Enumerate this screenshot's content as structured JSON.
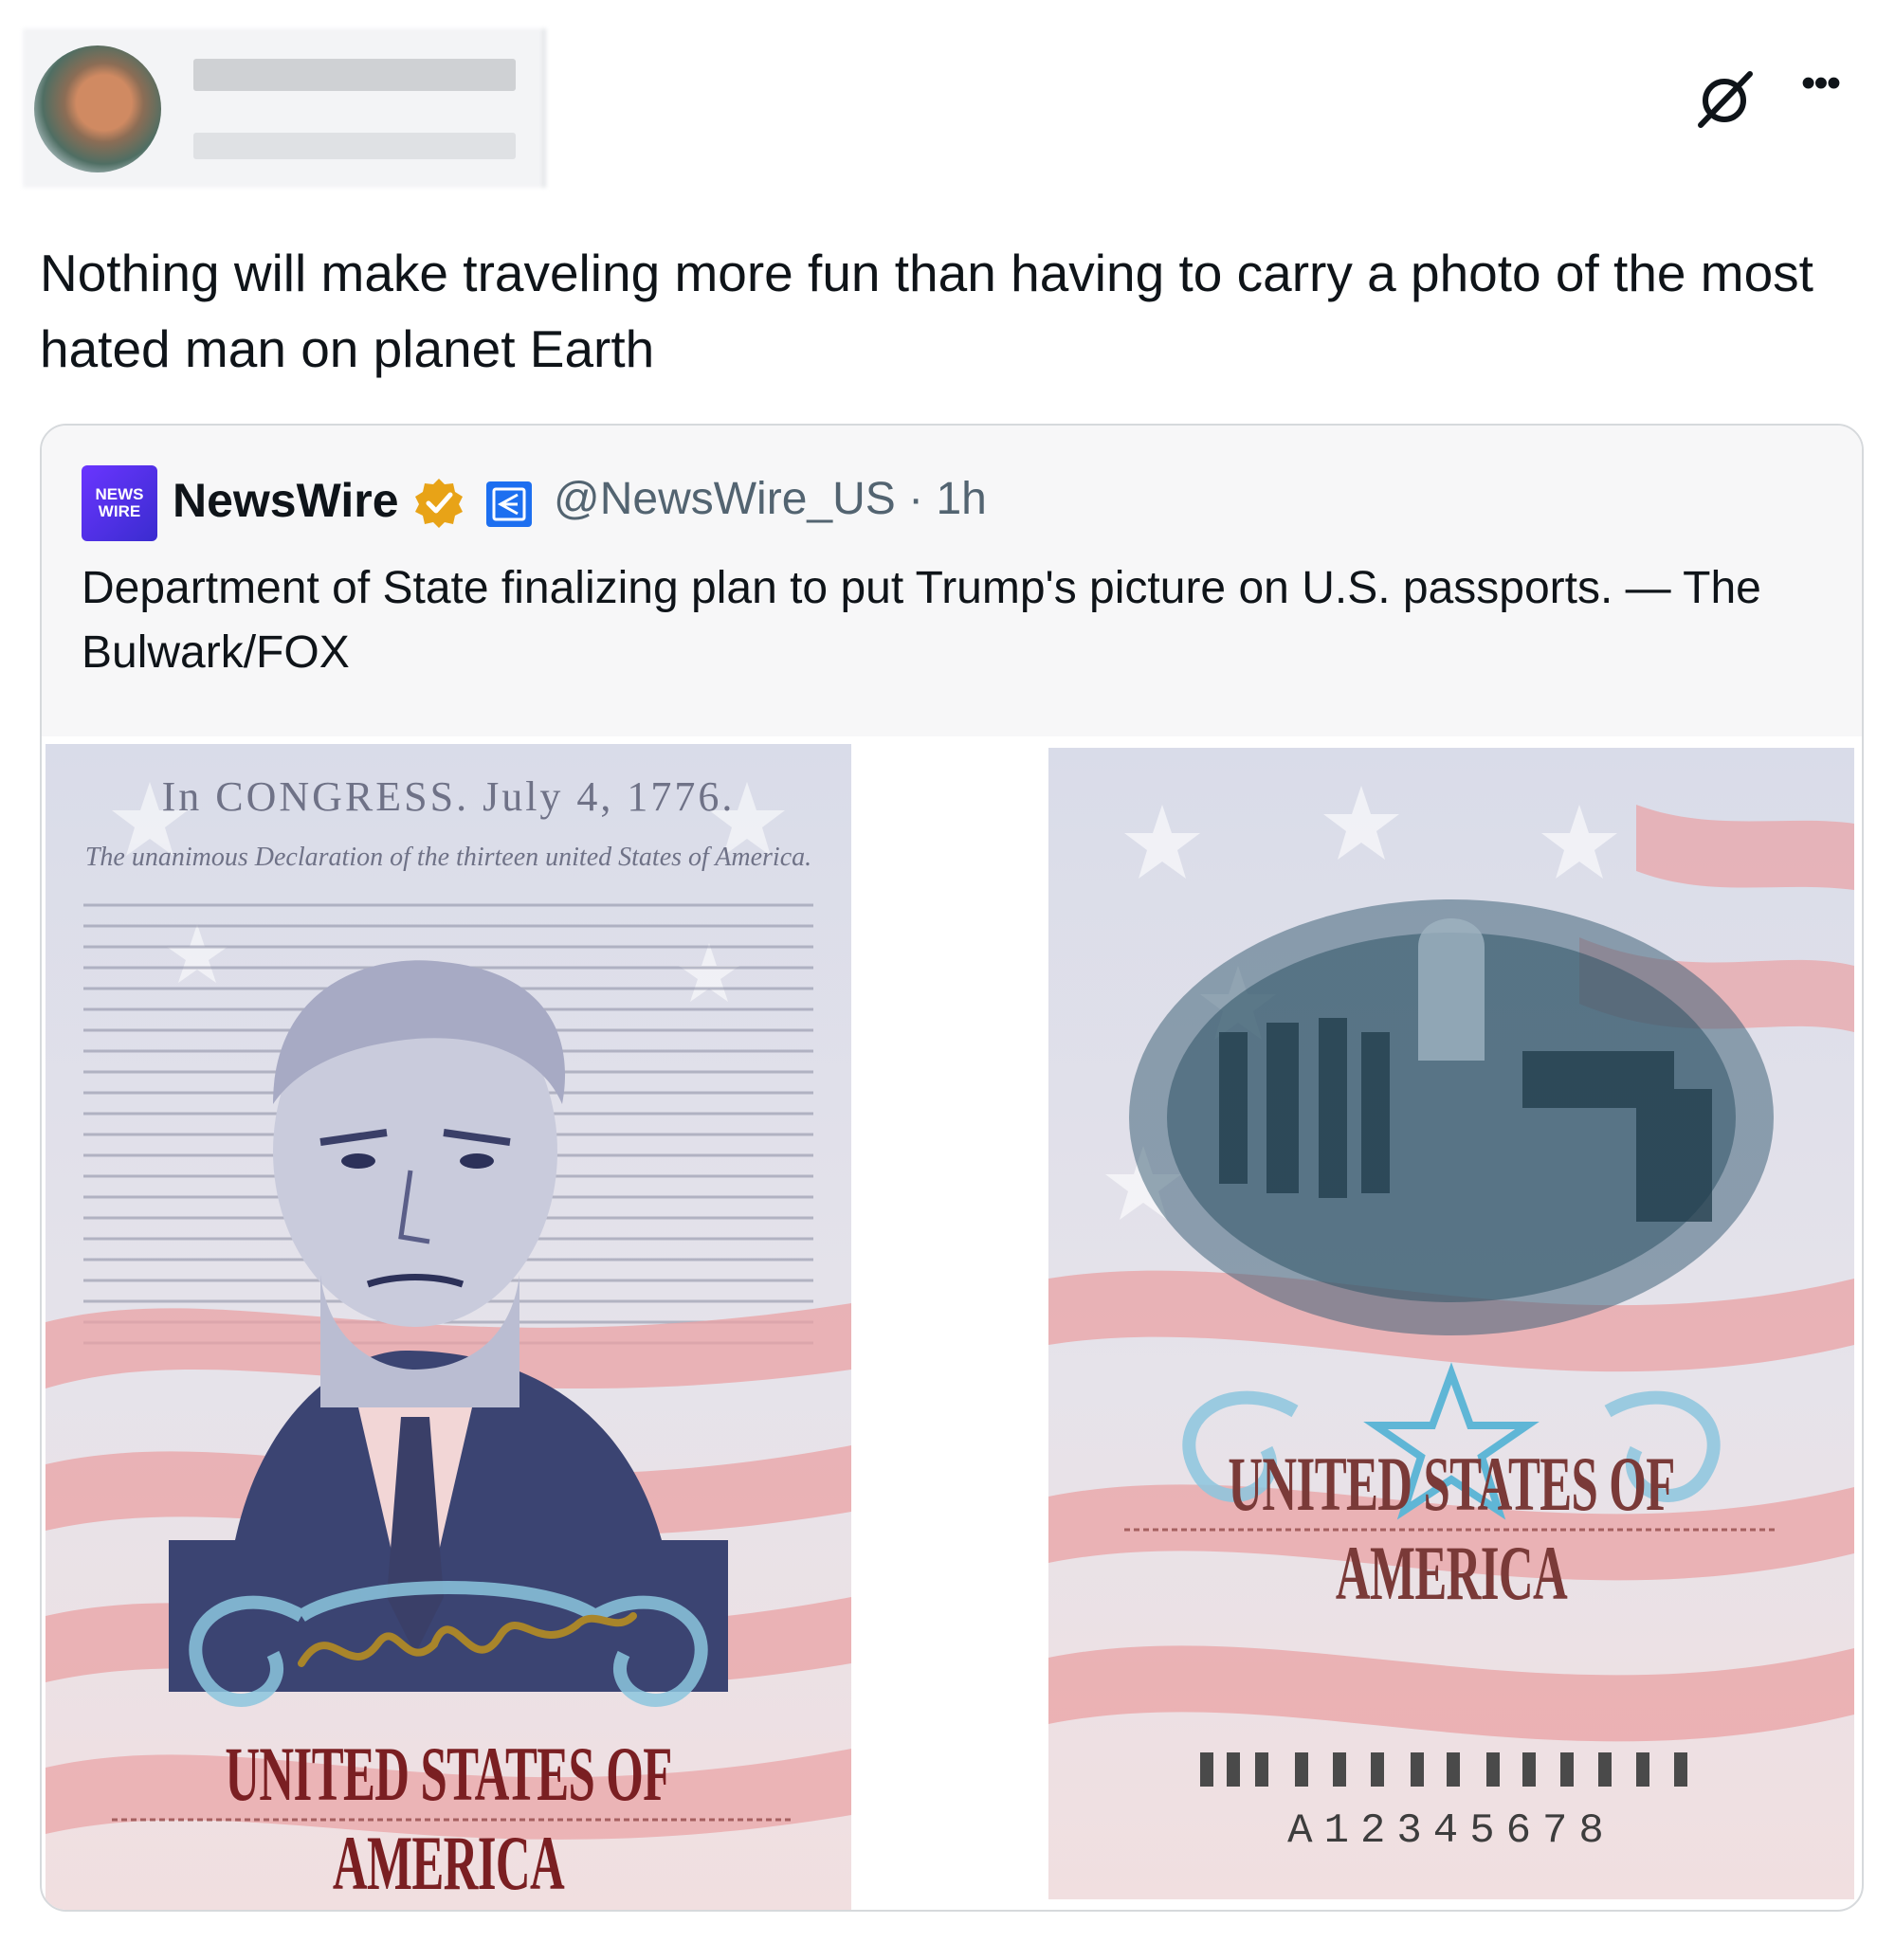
{
  "post": {
    "author_name": "",
    "author_handle": "",
    "text": "Nothing will make traveling more fun than having to carry a photo of the most hated man on planet Earth",
    "icons": [
      "grok-icon",
      "more-icon"
    ]
  },
  "quoted_post": {
    "logo_text_top": "NEWS",
    "logo_text_bottom": "WIRE",
    "display_name": "NewsWire",
    "handle": "@NewsWire_US",
    "time": "1h",
    "text": "Department of State finalizing plan to put Trump's picture on U.S. passports. — The Bulwark/FOX",
    "verified_color": "#e8a317",
    "affiliate_color": "#1d6ff0"
  },
  "passport": {
    "left_header": "In CONGRESS. July 4, 1776.",
    "left_subheader": "The unanimous Declaration of the thirteen united States of America.",
    "left_title": "UNITED STATES OF AMERICA",
    "right_title": "UNITED STATES OF AMERICA",
    "serial": "A12345678"
  }
}
